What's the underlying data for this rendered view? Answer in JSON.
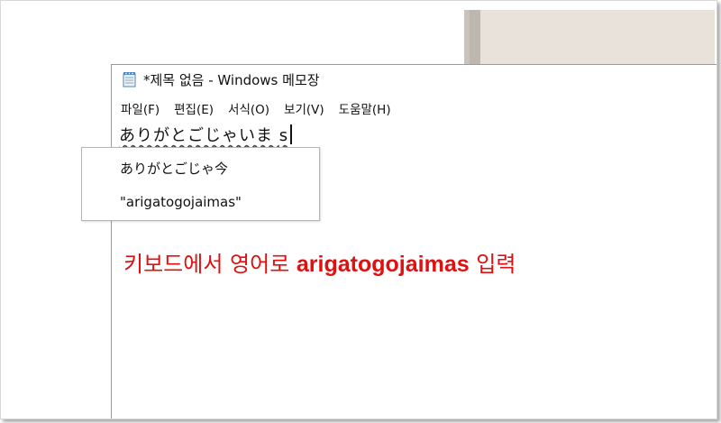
{
  "window": {
    "title": "*제목 없음 - Windows 메모장",
    "icon": "notepad-icon"
  },
  "menu": {
    "items": [
      "파일(F)",
      "편집(E)",
      "서식(O)",
      "보기(V)",
      "도움말(H)"
    ]
  },
  "editor": {
    "composing_text": "ありがとごじゃいま",
    "pending_romaji": "s"
  },
  "ime_candidates": {
    "items": [
      "ありがとごじゃ今",
      "\"arigatogojaimas\""
    ]
  },
  "annotation": {
    "prefix": "키보드에서 영어로 ",
    "bold": "arigatogojaimas",
    "suffix": " 입력",
    "color": "#e01010"
  }
}
